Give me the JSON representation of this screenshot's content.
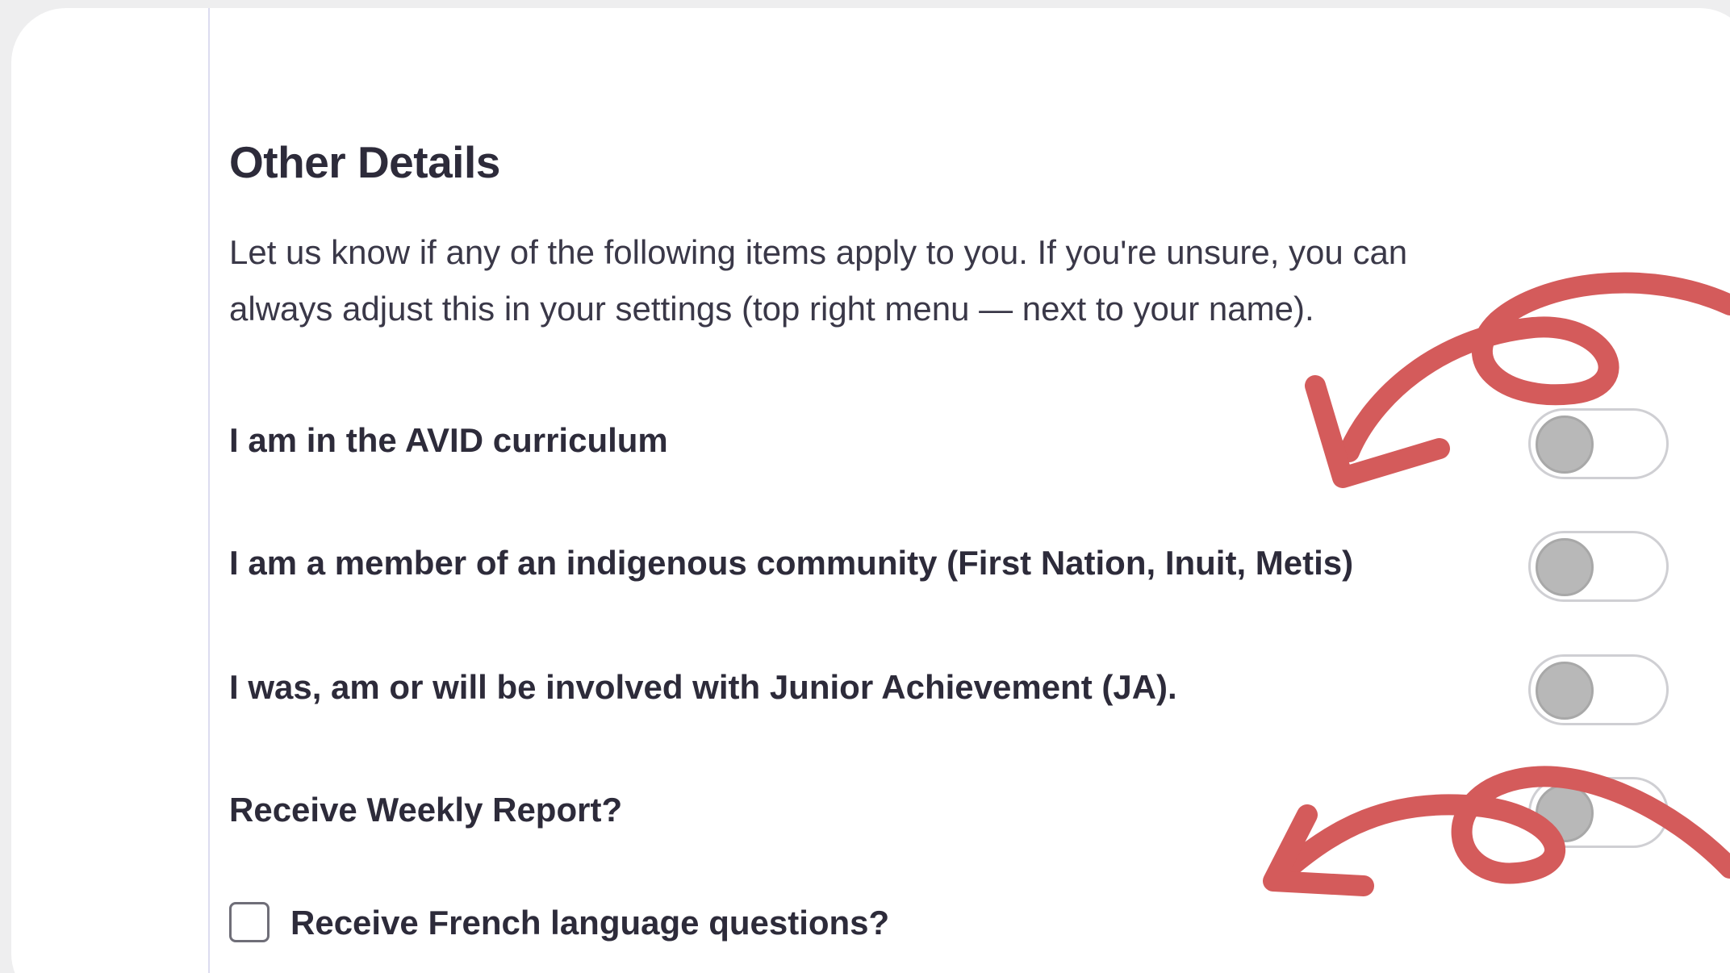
{
  "section": {
    "title": "Other Details",
    "description_line1": "Let us know if any of the following items apply to you. If you're unsure, you can",
    "description_line2": "always adjust this in your settings (top right menu — next to your name)."
  },
  "toggles": [
    {
      "label": "I am in the AVID curriculum",
      "checked": false
    },
    {
      "label": "I am a member of an indigenous community (First Nation, Inuit, Metis)",
      "checked": false
    },
    {
      "label": "I was, am or will be involved with Junior Achievement (JA).",
      "checked": false
    },
    {
      "label": "Receive Weekly Report?",
      "checked": false
    }
  ],
  "checkbox": {
    "label": "Receive French language questions?",
    "checked": false
  },
  "colors": {
    "annotation_arrow": "#d45b5b",
    "toggle_knob": "#b8b8b8",
    "divider": "#dcdcf0"
  }
}
